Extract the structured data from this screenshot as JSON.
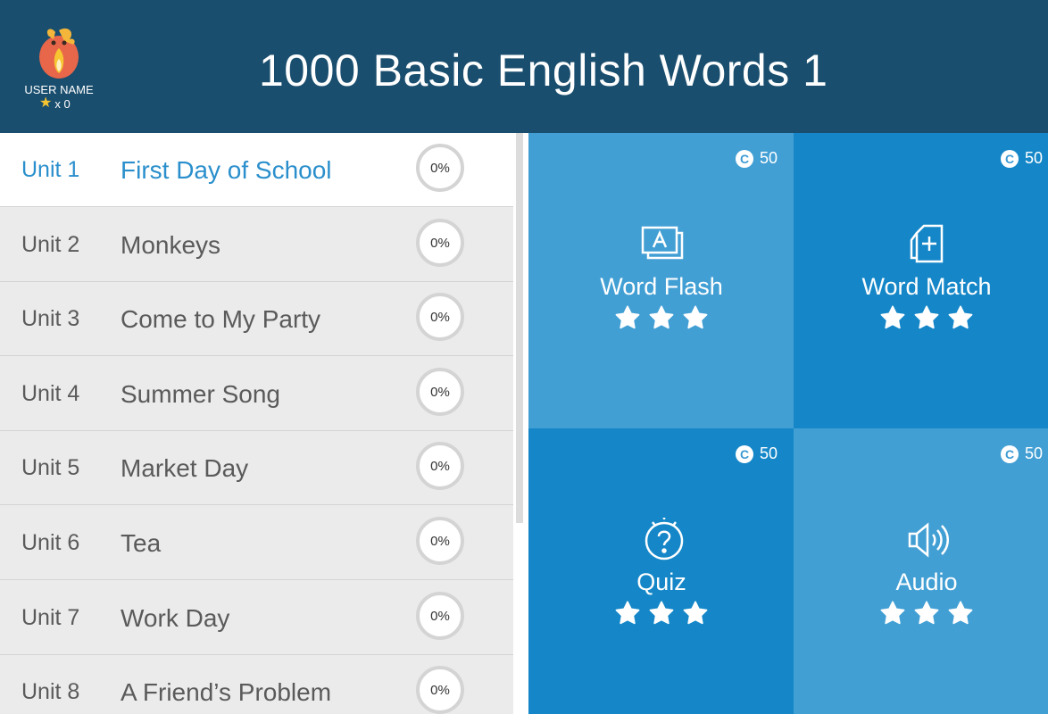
{
  "header": {
    "title": "1000 Basic English Words 1",
    "user_name": "USER NAME",
    "star_count": "x 0"
  },
  "units": [
    {
      "num": "Unit 1",
      "name": "First Day of School",
      "progress": "0%",
      "active": true
    },
    {
      "num": "Unit 2",
      "name": "Monkeys",
      "progress": "0%"
    },
    {
      "num": "Unit 3",
      "name": "Come to My Party",
      "progress": "0%"
    },
    {
      "num": "Unit 4",
      "name": "Summer Song",
      "progress": "0%"
    },
    {
      "num": "Unit 5",
      "name": "Market Day",
      "progress": "0%"
    },
    {
      "num": "Unit 6",
      "name": "Tea",
      "progress": "0%"
    },
    {
      "num": "Unit 7",
      "name": "Work Day",
      "progress": "0%"
    },
    {
      "num": "Unit 8",
      "name": "A Friend’s Problem",
      "progress": "0%"
    }
  ],
  "activities": [
    {
      "label": "Word Flash",
      "coins": "50",
      "coin_symbol": "C",
      "icon": "flashcard-icon",
      "stars": 3
    },
    {
      "label": "Word Match",
      "coins": "50",
      "coin_symbol": "C",
      "icon": "card-match-icon",
      "stars": 3
    },
    {
      "label": "Quiz",
      "coins": "50",
      "coin_symbol": "C",
      "icon": "question-icon",
      "stars": 3
    },
    {
      "label": "Audio",
      "coins": "50",
      "coin_symbol": "C",
      "icon": "speaker-icon",
      "stars": 3
    }
  ],
  "colors": {
    "header_bg": "#1a4e6e",
    "active_unit_text": "#2a8fcc",
    "tile_light": "#429fd4",
    "tile_dark": "#1587c8",
    "star_gold": "#f6c531"
  }
}
